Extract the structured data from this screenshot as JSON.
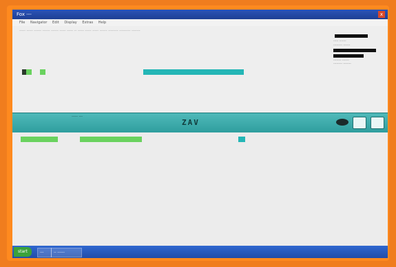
{
  "window": {
    "title": "Fox  ---",
    "close_label": "x"
  },
  "menubar": {
    "items": [
      "File",
      "Navigator",
      "Edit",
      "Display",
      "Extras",
      "Help"
    ]
  },
  "upper": {
    "info_text": "----- ----- ------ ------ ------ ----- ----- -- ----- ----- ----- ------ -------- --------- -------",
    "side_labels": [
      "----- -------",
      "--------- -------",
      "-------- -------",
      "--------- --------"
    ]
  },
  "toolbar": {
    "label": "-----  ---",
    "center_code": "ZAV"
  },
  "taskbar": {
    "start_label": "start",
    "items": [
      "---",
      "-- ------"
    ]
  }
}
